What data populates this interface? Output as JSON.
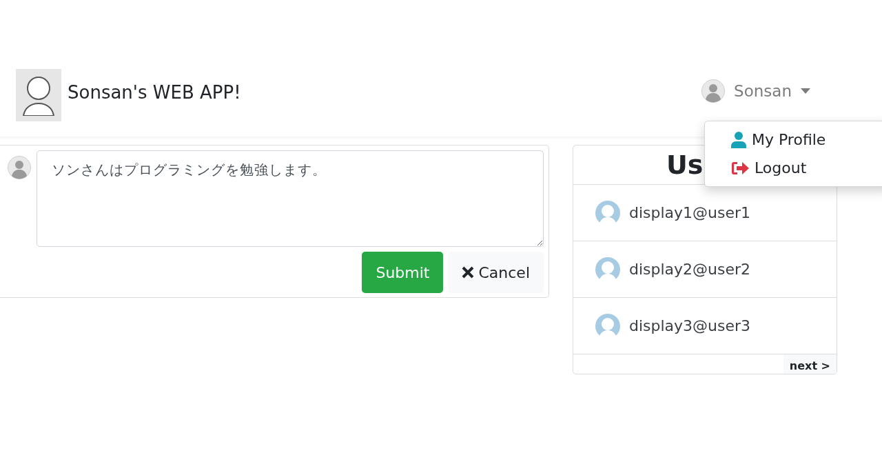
{
  "navbar": {
    "brand": "Sonsan's WEB APP!",
    "user_menu": {
      "label": "Sonsan",
      "expanded": true,
      "items": [
        {
          "kind": "profile",
          "label": "My Profile"
        },
        {
          "kind": "logout",
          "label": "Logout"
        }
      ]
    }
  },
  "post_form": {
    "value": "ソンさんはプログラミングを勉強します。",
    "buttons": [
      {
        "kind": "submit",
        "label": "Submit"
      },
      {
        "kind": "cancel",
        "label": "Cancel"
      }
    ]
  },
  "users_panel": {
    "title": "Us",
    "users": [
      {
        "name": "display1@user1"
      },
      {
        "name": "display2@user2"
      },
      {
        "name": "display3@user3"
      }
    ],
    "next": "next >"
  }
}
